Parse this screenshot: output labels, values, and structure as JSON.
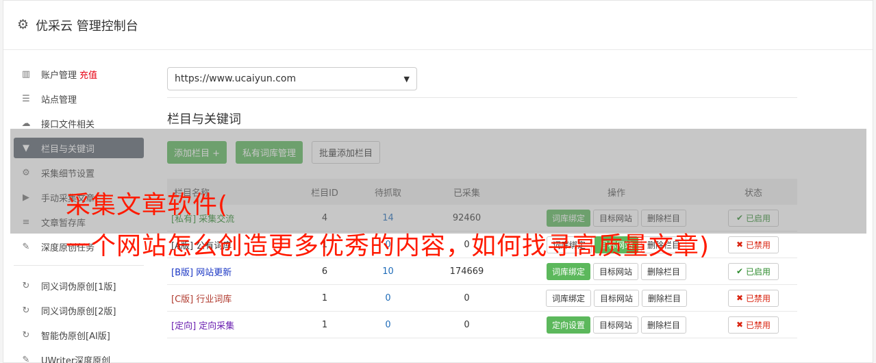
{
  "header": {
    "title": "优采云 管理控制台"
  },
  "sidebar": {
    "items": [
      {
        "label": "账户管理",
        "extra": "充值",
        "icon": "bar-chart-icon",
        "glyph": "▥",
        "active": false
      },
      {
        "label": "站点管理",
        "icon": "server-icon",
        "glyph": "☰",
        "active": false
      },
      {
        "label": "接口文件相关",
        "icon": "cloud-upload-icon",
        "glyph": "☁",
        "active": false
      },
      {
        "label": "栏目与关键词",
        "icon": "filter-icon",
        "glyph": "▼",
        "active": true
      },
      {
        "label": "采集细节设置",
        "icon": "cogs-icon",
        "glyph": "⚙",
        "active": false
      },
      {
        "label": "手动采集文章",
        "icon": "play-circle-icon",
        "glyph": "▶",
        "active": false
      },
      {
        "label": "文章暂存库",
        "icon": "database-icon",
        "glyph": "≡",
        "active": false
      },
      {
        "label": "深度原创任务",
        "icon": "edit-icon",
        "glyph": "✎",
        "active": false
      }
    ],
    "items2": [
      {
        "label": "同义词伪原创[1版]",
        "icon": "refresh-icon",
        "glyph": "↻"
      },
      {
        "label": "同义词伪原创[2版]",
        "icon": "refresh-icon",
        "glyph": "↻"
      },
      {
        "label": "智能伪原创[AI版]",
        "icon": "refresh-icon",
        "glyph": "↻"
      },
      {
        "label": "UWriter深度原创",
        "icon": "edit-icon",
        "glyph": "✎"
      }
    ]
  },
  "main": {
    "site_select": "https://www.ucaiyun.com",
    "section_title": "栏目与关键词",
    "buttons": {
      "add": "添加栏目 +",
      "private_lib": "私有词库管理",
      "batch_add": "批量添加栏目"
    },
    "table": {
      "headers": [
        "栏目名称",
        "栏目ID",
        "待抓取",
        "已采集",
        "操作",
        "状态"
      ],
      "rows": [
        {
          "tag": "[私有]",
          "name": "采集交流",
          "color": "#2e8b2e",
          "id": "4",
          "pending": "14",
          "collected": "92460",
          "op1": "词库绑定",
          "op1_green": true,
          "op2": "目标网站",
          "op3": "删除栏目",
          "status": "已启用",
          "status_on": true
        },
        {
          "tag": "[A版]",
          "name": "公有词库",
          "color": "#333333",
          "id": "1",
          "pending": "0",
          "collected": "0",
          "op1": "词库绑定",
          "op1_green": false,
          "op2": "目标网站",
          "op2_green": true,
          "op3": "删除栏目",
          "status": "已禁用",
          "status_on": false
        },
        {
          "tag": "[B版]",
          "name": "网站更新",
          "color": "#1a36c4",
          "id": "6",
          "pending": "10",
          "collected": "174669",
          "op1": "词库绑定",
          "op1_green": true,
          "op2": "目标网站",
          "op3": "删除栏目",
          "status": "已启用",
          "status_on": true
        },
        {
          "tag": "[C版]",
          "name": "行业词库",
          "color": "#b03a2e",
          "id": "1",
          "pending": "0",
          "collected": "0",
          "op1": "词库绑定",
          "op1_green": false,
          "op2": "目标网站",
          "op3": "删除栏目",
          "status": "已禁用",
          "status_on": false
        },
        {
          "tag": "[定向]",
          "name": "定向采集",
          "color": "#6a1fb0",
          "id": "1",
          "pending": "0",
          "collected": "0",
          "op1": "定向设置",
          "op1_green": true,
          "op2": "目标网站",
          "op3": "删除栏目",
          "status": "已禁用",
          "status_on": false
        }
      ]
    }
  },
  "overlay": {
    "line1": "采集文章软件(",
    "line2": "一个网站怎么创造更多优秀的内容，如何找寻高质量文章)"
  }
}
